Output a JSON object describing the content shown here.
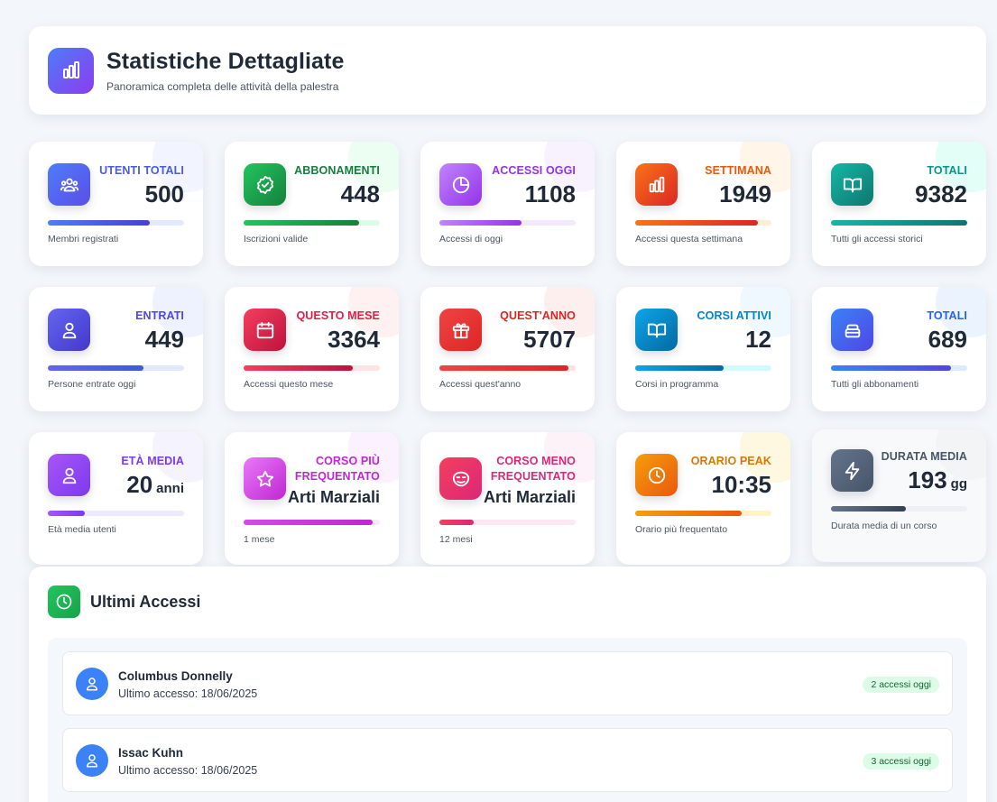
{
  "header": {
    "title": "Statistiche Dettagliate",
    "subtitle": "Panoramica completa delle attività della palestra",
    "icon": "bar-chart-icon"
  },
  "cards": [
    {
      "label": "Utenti Totali",
      "value": "500",
      "desc": "Membri registrati",
      "progress": 0.75,
      "color": "#4a5be0",
      "icon": "users-icon"
    },
    {
      "label": "Abbonamenti",
      "value": "448",
      "desc": "Iscrizioni valide",
      "progress": 0.85,
      "color": "#16a34a",
      "icon": "badge-check-icon"
    },
    {
      "label": "Accessi Oggi",
      "value": "1108",
      "desc": "Accessi di oggi",
      "progress": 0.6,
      "color": "#a855f7",
      "icon": "pie-chart-icon"
    },
    {
      "label": "Settimana",
      "value": "1949",
      "desc": "Accessi questa settimana",
      "progress": 0.9,
      "color": "#ea580c",
      "icon": "bar-chart-icon"
    },
    {
      "label": "Totali",
      "value": "9382",
      "desc": "Tutti gli accessi storici",
      "progress": 1.0,
      "color": "#0d9488",
      "icon": "book-open-icon"
    },
    {
      "label": "Entrati",
      "value": "449",
      "desc": "Persone entrate oggi",
      "progress": 0.7,
      "color": "#4f46e5",
      "icon": "user-icon"
    },
    {
      "label": "Questo Mese",
      "value": "3364",
      "desc": "Accessi questo mese",
      "progress": 0.8,
      "color": "#e11d48",
      "icon": "calendar-icon"
    },
    {
      "label": "Quest'anno",
      "value": "5707",
      "desc": "Accessi quest'anno",
      "progress": 0.95,
      "color": "#dc2626",
      "icon": "gift-icon"
    },
    {
      "label": "Corsi Attivi",
      "value": "12",
      "desc": "Corsi in programma",
      "progress": 0.65,
      "color": "#0ea5e9",
      "icon": "book-open-icon"
    },
    {
      "label": "Totali",
      "value": "689",
      "desc": "Tutti gli abbonamenti",
      "progress": 0.88,
      "color": "#3b82f6",
      "icon": "package-icon"
    },
    {
      "label": "Età Media",
      "value": "20",
      "unit": "anni",
      "desc": "Età media utenti",
      "progress": 0.27,
      "color": "#8b5cf6",
      "icon": "user-icon"
    },
    {
      "label": "Corso più frequentato",
      "value": "Arti Marziali",
      "desc": "1 mese",
      "progress": 0.95,
      "color": "#d946ef",
      "icon": "star-icon"
    },
    {
      "label": "Corso meno frequentato",
      "value": "Arti Marziali",
      "desc": "12 mesi",
      "progress": 0.25,
      "color": "#e11d48",
      "icon": "mask-icon"
    },
    {
      "label": "Orario Peak",
      "value": "10:35",
      "desc": "Orario più frequentato",
      "progress": 0.78,
      "color": "#f59e0b",
      "icon": "clock-icon"
    },
    {
      "label": "Durata Media",
      "value": "193",
      "unit": "gg",
      "desc": "Durata media di un corso",
      "progress": 0.55,
      "color": "#475569",
      "icon": "zap-icon"
    }
  ],
  "last_access": {
    "title": "Ultimi Accessi",
    "icon": "clock-icon",
    "rows": [
      {
        "name": "Columbus Donnelly",
        "last": "Ultimo accesso: 18/06/2025",
        "badge": "2 accessi oggi"
      },
      {
        "name": "Issac Kuhn",
        "last": "Ultimo accesso: 18/06/2025",
        "badge": "3 accessi oggi"
      }
    ]
  }
}
